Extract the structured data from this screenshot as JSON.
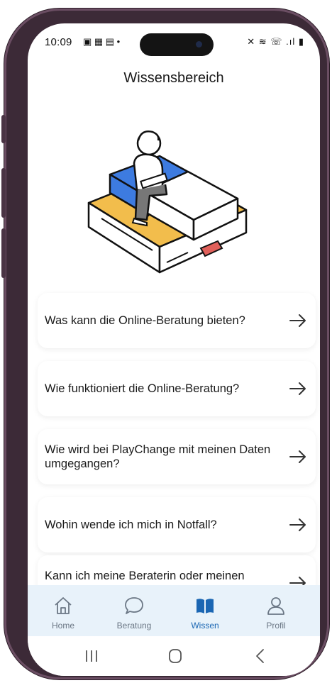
{
  "status_bar": {
    "time": "10:09",
    "left_icons": "▣ ▦ ▤ •",
    "right_icons": "✕ ≋ ☏ .ıl ▮"
  },
  "header": {
    "title": "Wissensbereich"
  },
  "faq": {
    "items": [
      {
        "question": "Was kann die Online-Beratung bieten?"
      },
      {
        "question": "Wie funktioniert die Online-Beratung?"
      },
      {
        "question": "Wie wird bei PlayChange mit meinen Daten umgegangen?"
      },
      {
        "question": "Wohin wende ich mich in Notfall?"
      },
      {
        "question": "Kann ich meine Beraterin oder meinen Berater persönlich treffen?"
      }
    ]
  },
  "tabbar": {
    "tabs": [
      {
        "label": "Home",
        "icon": "home-icon"
      },
      {
        "label": "Beratung",
        "icon": "chat-bubble-icon"
      },
      {
        "label": "Wissen",
        "icon": "open-book-icon",
        "active": true
      },
      {
        "label": "Profil",
        "icon": "person-icon"
      }
    ]
  },
  "colors": {
    "accent": "#1a66b3",
    "tabbar_bg": "#e8f2fa",
    "illustration_blue": "#3d7be0",
    "illustration_yellow": "#f2bd4c",
    "illustration_red": "#e0605a"
  }
}
